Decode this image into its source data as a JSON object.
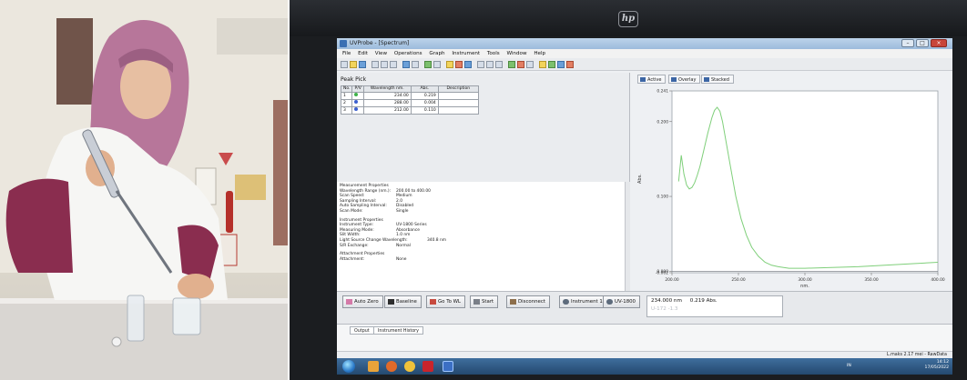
{
  "window": {
    "title": "UVProbe - [Spectrum]",
    "controls": [
      "–",
      "□",
      "×"
    ]
  },
  "brand": {
    "monitor_logo": "hp"
  },
  "menu": [
    "File",
    "Edit",
    "View",
    "Operations",
    "Graph",
    "Instrument",
    "Tools",
    "Window",
    "Help"
  ],
  "peak_pick": {
    "title": "Peak Pick",
    "columns": [
      "No.",
      "P/V",
      "Wavelength nm.",
      "Abs.",
      "Description"
    ],
    "rows": [
      {
        "no": "1",
        "pv": "green",
        "wavelength": "234.00",
        "abs": "0.219",
        "desc": ""
      },
      {
        "no": "2",
        "pv": "blue",
        "wavelength": "288.00",
        "abs": "0.004",
        "desc": ""
      },
      {
        "no": "3",
        "pv": "blue",
        "wavelength": "212.00",
        "abs": "0.110",
        "desc": ""
      }
    ]
  },
  "properties": {
    "measurement_title": "Measurement Properties",
    "measurement": [
      {
        "k": "Wavelength Range (nm.):",
        "v": "200.00 to 400.00"
      },
      {
        "k": "Scan Speed:",
        "v": "Medium"
      },
      {
        "k": "Sampling Interval:",
        "v": "2.0"
      },
      {
        "k": "Auto Sampling Interval:",
        "v": "Disabled"
      },
      {
        "k": "Scan Mode:",
        "v": "Single"
      }
    ],
    "instrument_title": "Instrument Properties",
    "instrument": [
      {
        "k": "Instrument Type:",
        "v": "UV-1800 Series"
      },
      {
        "k": "Measuring Mode:",
        "v": "Absorbance"
      },
      {
        "k": "Slit Width:",
        "v": "1.0 nm"
      },
      {
        "k": "Light Source Change Wavelength:",
        "v": "340.8 nm"
      },
      {
        "k": "S/R Exchange:",
        "v": "Normal"
      }
    ],
    "attachment_title": "Attachment Properties",
    "attachment": [
      {
        "k": "Attachment:",
        "v": "None"
      }
    ]
  },
  "graph_tabs": [
    "Active",
    "Overlay",
    "Stacked"
  ],
  "chart_data": {
    "type": "line",
    "title": "",
    "xlabel": "nm.",
    "ylabel": "Abs.",
    "xlim": [
      200,
      400
    ],
    "ylim": [
      -0.002,
      0.241
    ],
    "x_ticks": [
      "200.00",
      "250.00",
      "300.00",
      "350.00",
      "400.00"
    ],
    "y_ticks": [
      "0.241",
      "0.200",
      "0.100",
      "0.000",
      "-0.002"
    ],
    "grid": false,
    "series": [
      {
        "color": "#7fcf7a",
        "x": [
          205,
          207,
          209,
          211,
          213,
          215,
          217,
          219,
          221,
          224,
          227,
          230,
          232,
          234,
          236,
          238,
          240,
          244,
          248,
          252,
          256,
          260,
          265,
          270,
          275,
          280,
          288,
          300,
          320,
          340,
          360,
          380,
          400
        ],
        "y": [
          0.12,
          0.155,
          0.13,
          0.115,
          0.11,
          0.112,
          0.118,
          0.128,
          0.14,
          0.162,
          0.185,
          0.205,
          0.215,
          0.219,
          0.214,
          0.2,
          0.18,
          0.14,
          0.1,
          0.07,
          0.048,
          0.032,
          0.02,
          0.012,
          0.008,
          0.006,
          0.004,
          0.004,
          0.005,
          0.006,
          0.008,
          0.01,
          0.012
        ]
      }
    ],
    "baseline_y": 0.0
  },
  "actions": {
    "auto_zero": "Auto Zero",
    "baseline": "Baseline",
    "goto_wl": "Go To WL",
    "start": "Start",
    "disconnect": "Disconnect",
    "instrument_label": "Instrument 1",
    "instrument_model": "UV-1800"
  },
  "readout": {
    "wavelength": "234.000 nm",
    "abs": "0.219 Abs.",
    "ghost": "U-172  -1.3"
  },
  "output_tabs": [
    "Output",
    "Instrument History"
  ],
  "status": {
    "text": "L.maks 2.17 mei - RawData"
  },
  "taskbar": {
    "lang": "IN",
    "time": "14:12",
    "date": "17/05/2022"
  }
}
